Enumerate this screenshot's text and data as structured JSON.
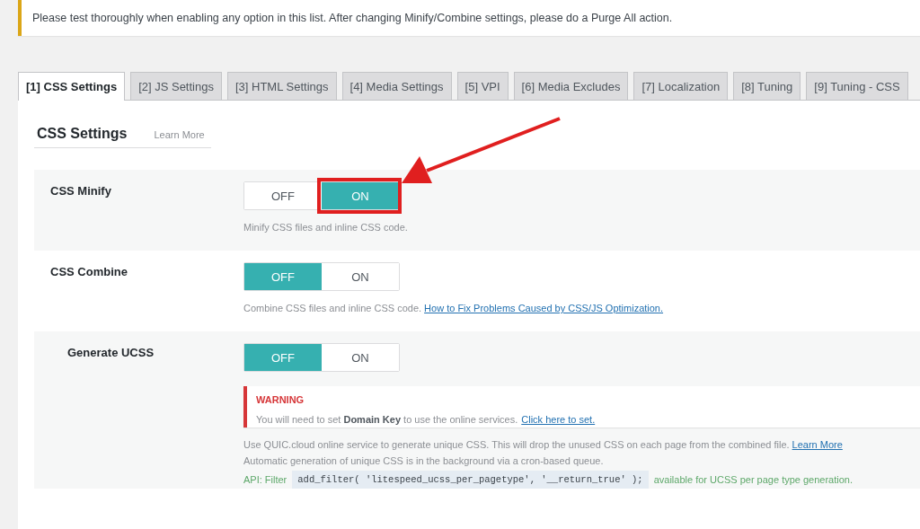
{
  "notice": "Please test thoroughly when enabling any option in this list. After changing Minify/Combine settings, please do a Purge All action.",
  "tabs": [
    {
      "label": "[1] CSS Settings",
      "selected": true
    },
    {
      "label": "[2] JS Settings",
      "selected": false
    },
    {
      "label": "[3] HTML Settings",
      "selected": false
    },
    {
      "label": "[4] Media Settings",
      "selected": false
    },
    {
      "label": "[5] VPI",
      "selected": false
    },
    {
      "label": "[6] Media Excludes",
      "selected": false
    },
    {
      "label": "[7] Localization",
      "selected": false
    },
    {
      "label": "[8] Tuning",
      "selected": false
    },
    {
      "label": "[9] Tuning - CSS",
      "selected": false
    }
  ],
  "section": {
    "title": "CSS Settings",
    "link": "Learn More"
  },
  "settings": [
    {
      "label": "CSS Minify",
      "options": [
        {
          "label": "OFF",
          "selected": false,
          "highlighted": false
        },
        {
          "label": "ON",
          "selected": true,
          "highlighted": true
        }
      ],
      "description": [
        {
          "text": "Minify CSS files and inline CSS code."
        }
      ]
    },
    {
      "label": "CSS Combine",
      "options": [
        {
          "label": "OFF",
          "selected": true,
          "highlighted": false
        },
        {
          "label": "ON",
          "selected": false,
          "highlighted": false
        }
      ],
      "description": [
        {
          "text": "Combine CSS files and inline CSS code.",
          "link": "How to Fix Problems Caused by CSS/JS Optimization."
        }
      ],
      "children": [
        {
          "label": "Generate UCSS",
          "options": [
            {
              "label": "OFF",
              "selected": true,
              "highlighted": false
            },
            {
              "label": "ON",
              "selected": false,
              "highlighted": false
            }
          ],
          "warning": {
            "title": "WARNING",
            "text": "You will need to set **Domain Key** to use the online services.",
            "link": "Click here to set."
          },
          "description": [
            {
              "text": "Use QUIC.cloud online service to generate unique CSS. This will drop the unused CSS on each page from the combined file.",
              "link": "Learn More"
            },
            {
              "text": "Automatic generation of unique CSS is in the background via a cron-based queue."
            }
          ],
          "api": {
            "prefix": "API: Filter",
            "code": "add_filter( 'litespeed_ucss_per_pagetype', '__return_true' );",
            "suffix": "available for UCSS per page type generation."
          }
        }
      ]
    }
  ]
}
